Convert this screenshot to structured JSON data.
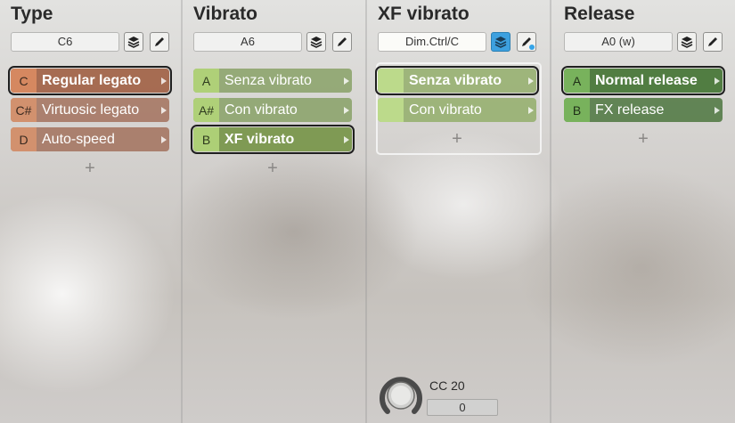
{
  "columns": [
    {
      "title": "Type",
      "key_field": "C6",
      "articulations": [
        {
          "key": "C",
          "label": "Regular legato"
        },
        {
          "key": "C#",
          "label": "Virtuosic legato"
        },
        {
          "key": "D",
          "label": "Auto-speed"
        }
      ]
    },
    {
      "title": "Vibrato",
      "key_field": "A6",
      "articulations": [
        {
          "key": "A",
          "label": "Senza vibrato"
        },
        {
          "key": "A#",
          "label": "Con vibrato"
        },
        {
          "key": "B",
          "label": "XF vibrato"
        }
      ]
    },
    {
      "title": "XF vibrato",
      "key_field": "Dim.Ctrl/C",
      "articulations": [
        {
          "key": "",
          "label": "Senza vibrato"
        },
        {
          "key": "",
          "label": "Con vibrato"
        }
      ]
    },
    {
      "title": "Release",
      "key_field": "A0 (w)",
      "articulations": [
        {
          "key": "A",
          "label": "Normal release"
        },
        {
          "key": "B",
          "label": "FX release"
        }
      ]
    }
  ],
  "add_label": "+",
  "controller": {
    "cc_label": "CC 20",
    "value": "0"
  },
  "icons": {
    "layers": "layers-icon",
    "edit": "pencil-icon",
    "arrow": "play-arrow-icon",
    "knob": "knob-icon"
  }
}
